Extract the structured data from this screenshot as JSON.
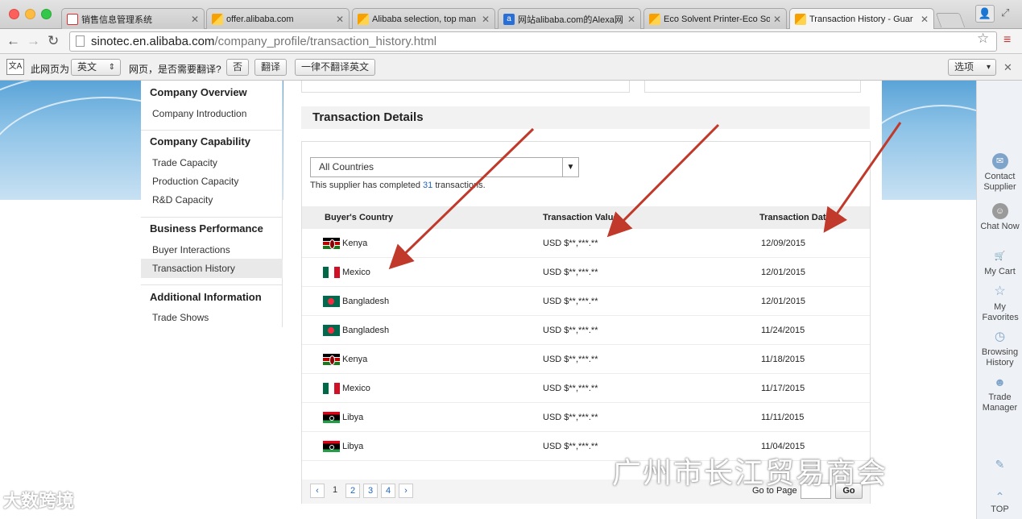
{
  "tabs": [
    {
      "title": "销售信息管理系统",
      "icon": "red-doc"
    },
    {
      "title": "offer.alibaba.com",
      "icon": "alibaba"
    },
    {
      "title": "Alibaba selection, top man",
      "icon": "alibaba"
    },
    {
      "title": "网站alibaba.com的Alexa网",
      "icon": "alexa"
    },
    {
      "title": "Eco Solvent Printer-Eco Sol",
      "icon": "alibaba"
    },
    {
      "title": "Transaction History - Guar",
      "icon": "alibaba",
      "active": true
    }
  ],
  "address": {
    "host": "sinotec.en.alibaba.com",
    "path": "/company_profile/transaction_history.html"
  },
  "translate_bar": {
    "prefix": "此网页为",
    "language": "英文",
    "question": "网页，是否需要翻译?",
    "no_label": "否",
    "translate_label": "翻译",
    "never_label": "一律不翻译英文",
    "options_label": "选项"
  },
  "sidebar": {
    "sections": [
      {
        "heading": "Company Overview",
        "items": [
          "Company Introduction"
        ]
      },
      {
        "heading": "Company Capability",
        "items": [
          "Trade Capacity",
          "Production Capacity",
          "R&D Capacity"
        ]
      },
      {
        "heading": "Business Performance",
        "items": [
          "Buyer Interactions",
          "Transaction History"
        ]
      },
      {
        "heading": "Additional Information",
        "items": [
          "Trade Shows"
        ]
      }
    ],
    "active_item": "Transaction History"
  },
  "main": {
    "section_title": "Transaction Details",
    "country_filter": "All Countries",
    "summary_prefix": "This supplier has completed ",
    "summary_count": "31",
    "summary_suffix": " transactions.",
    "columns": [
      "Buyer's Country",
      "Transaction Value",
      "Transaction Date"
    ],
    "rows": [
      {
        "country": "Kenya",
        "flag": "kenya",
        "value": "USD $**,***.**",
        "date": "12/09/2015"
      },
      {
        "country": "Mexico",
        "flag": "mexico",
        "value": "USD $**,***.**",
        "date": "12/01/2015"
      },
      {
        "country": "Bangladesh",
        "flag": "bangladesh",
        "value": "USD $**,***.**",
        "date": "12/01/2015"
      },
      {
        "country": "Bangladesh",
        "flag": "bangladesh",
        "value": "USD $**,***.**",
        "date": "11/24/2015"
      },
      {
        "country": "Kenya",
        "flag": "kenya",
        "value": "USD $**,***.**",
        "date": "11/18/2015"
      },
      {
        "country": "Mexico",
        "flag": "mexico",
        "value": "USD $**,***.**",
        "date": "11/17/2015"
      },
      {
        "country": "Libya",
        "flag": "libya",
        "value": "USD $**,***.**",
        "date": "11/11/2015"
      },
      {
        "country": "Libya",
        "flag": "libya",
        "value": "USD $**,***.**",
        "date": "11/04/2015"
      }
    ],
    "pagination": {
      "prev": "‹",
      "pages": [
        "1",
        "2",
        "3",
        "4"
      ],
      "current": "1",
      "next": "›",
      "goto_label": "Go to Page",
      "go_label": "Go"
    }
  },
  "right_rail": [
    {
      "label": "Contact Supplier",
      "icon": "mail-icon"
    },
    {
      "label": "Chat Now",
      "icon": "chat-icon"
    },
    {
      "label": "My Cart",
      "icon": "cart-icon"
    },
    {
      "label": "My Favorites",
      "icon": "star-icon"
    },
    {
      "label": "Browsing History",
      "icon": "clock-icon"
    },
    {
      "label": "Trade Manager",
      "icon": "trademanager-icon"
    },
    {
      "label": "TOP",
      "icon": "up-icon"
    }
  ],
  "watermarks": {
    "left": "大数跨境",
    "right": "广州市长江贸易商会"
  },
  "colors": {
    "link": "#2266bb",
    "annotation_arrow": "#c0392b",
    "banner": "#5aa4d8"
  }
}
